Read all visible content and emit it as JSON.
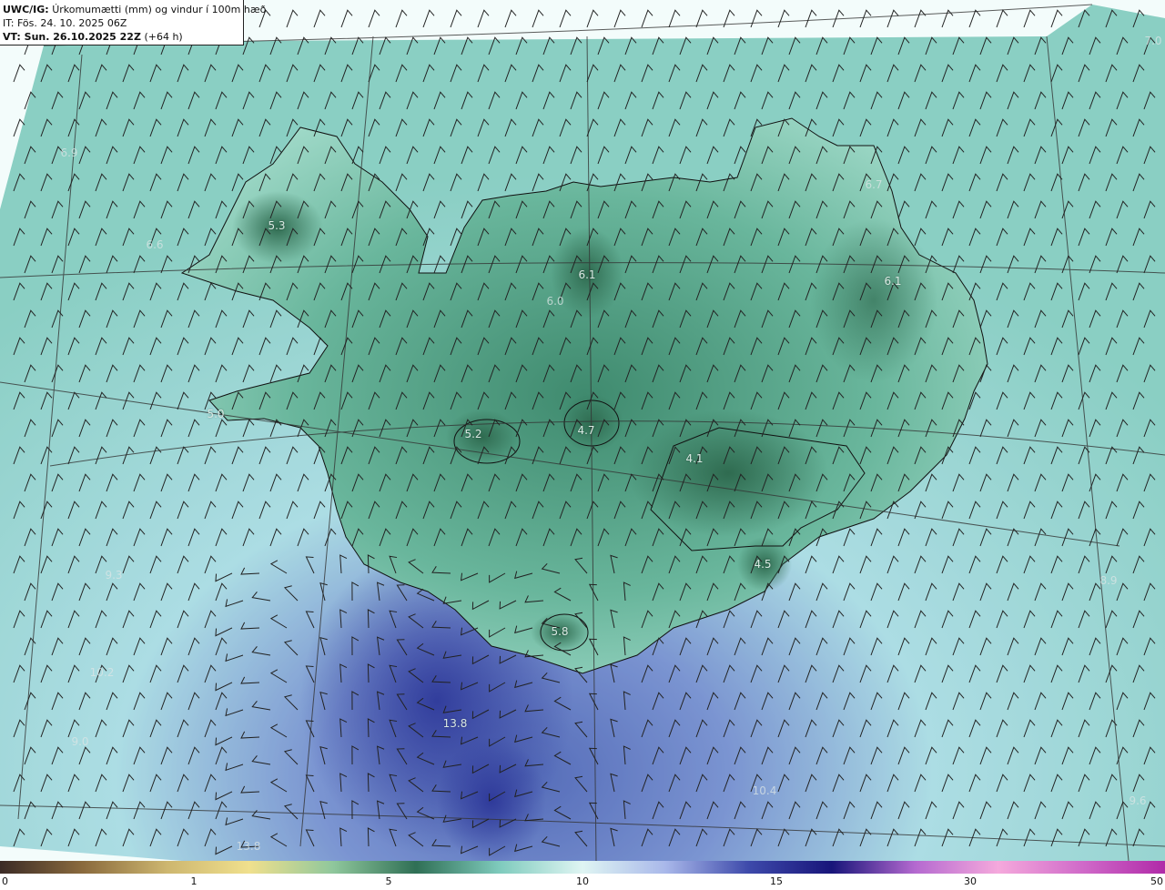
{
  "header": {
    "model_tag": "UWC/IG:",
    "product": "Úrkomumætti (mm) og vindur í 100m hæð",
    "init_time": "IT: Fös. 24. 10. 2025 06Z",
    "valid_prefix": "VT: Sun. 26.10.2025 22Z",
    "lead_time": "(+64 h)"
  },
  "map_values": [
    {
      "label": "7.0",
      "faint": true
    },
    {
      "label": "6.9",
      "faint": true
    },
    {
      "label": "5.3",
      "faint": false
    },
    {
      "label": "6.6",
      "faint": true
    },
    {
      "label": "6.1",
      "faint": false
    },
    {
      "label": "6.1",
      "faint": false
    },
    {
      "label": "6.7",
      "faint": true
    },
    {
      "label": "6.0",
      "faint": true
    },
    {
      "label": "5.0",
      "faint": false
    },
    {
      "label": "5.2",
      "faint": false
    },
    {
      "label": "4.7",
      "faint": false
    },
    {
      "label": "4.1",
      "faint": false
    },
    {
      "label": "4.5",
      "faint": false
    },
    {
      "label": "5.8",
      "faint": false
    },
    {
      "label": "9.3",
      "faint": true
    },
    {
      "label": "10.2",
      "faint": true
    },
    {
      "label": "13.8",
      "faint": false
    },
    {
      "label": "9.0",
      "faint": true
    },
    {
      "label": "8.9",
      "faint": true
    },
    {
      "label": "10.4",
      "faint": true
    },
    {
      "label": "9.6",
      "faint": true
    },
    {
      "label": "13.8",
      "faint": true
    }
  ],
  "colorbar": {
    "ticks": [
      "0",
      "1",
      "5",
      "10",
      "15",
      "30",
      "50"
    ],
    "colors": [
      "#3b2b26",
      "#8a6a3d",
      "#cdb66f",
      "#f0e08d",
      "#8fc79c",
      "#2f6f55",
      "#7fcbbd",
      "#dff5f3",
      "#a9b8ea",
      "#3d49aa",
      "#18157a",
      "#b56ad0",
      "#f5a9dc",
      "#d06ac9",
      "#b02aa8"
    ]
  }
}
